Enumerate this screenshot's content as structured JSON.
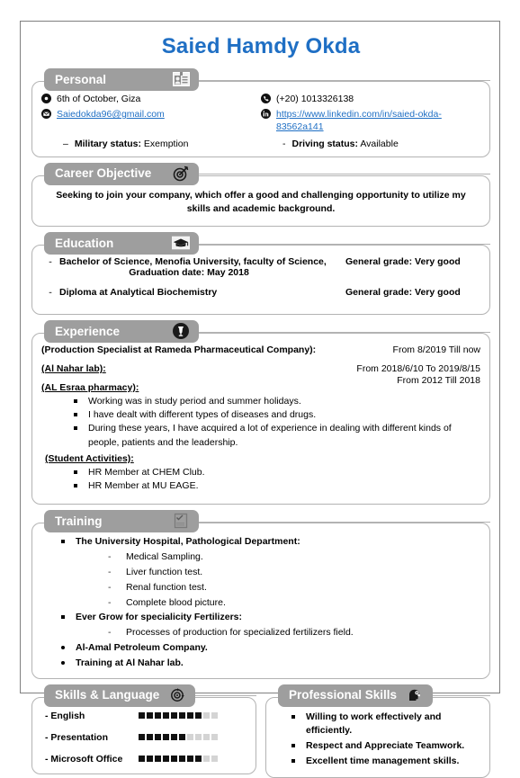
{
  "name": "Saied Hamdy Okda",
  "accent_color": "#1F6FC4",
  "header_color": "#9e9e9e",
  "sections": {
    "personal": {
      "title": "Personal",
      "icon": "id-card-icon",
      "location": "6th of October, Giza",
      "email": "Saiedokda96@gmail.com",
      "phone": "(+20) 1013326138",
      "linkedin": "https://www.linkedin.com/in/saied-okda-83562a141",
      "military_label": "Military status:",
      "military_value": "Exemption",
      "driving_label": "Driving status:",
      "driving_value": "Available"
    },
    "objective": {
      "title": "Career Objective",
      "icon": "target-icon",
      "text": "Seeking to join your company, which offer a good and challenging opportunity to utilize my skills and academic background."
    },
    "education": {
      "title": "Education",
      "icon": "graduation-cap-icon",
      "items": [
        {
          "line1": "Bachelor of Science, Menofia University, faculty of Science,",
          "line2": "Graduation date: May 2018",
          "grade": "General grade: Very good"
        },
        {
          "line1": "Diploma at Analytical Biochemistry",
          "line2": "",
          "grade": "General grade: Very good"
        }
      ]
    },
    "experience": {
      "title": "Experience",
      "icon": "briefcase-badge-icon",
      "roles": [
        {
          "title": "(Production Specialist at Rameda Pharmaceutical Company):",
          "date": "From 8/2019 Till now"
        },
        {
          "title": "(Al Nahar lab):",
          "date": "From 2018/6/10 To 2019/8/15"
        },
        {
          "title": " (AL Esraa pharmacy):",
          "date": "From 2012 Till 2018"
        }
      ],
      "esraa_points": [
        "Working was in study period and summer holidays.",
        "I have dealt with different types of diseases and drugs.",
        "During these years, I have acquired a lot of experience in dealing with different kinds of people, patients and the leadership."
      ],
      "activities_title": "(Student Activities):",
      "activities": [
        "HR Member at CHEM Club.",
        "HR Member at MU EAGE."
      ]
    },
    "training": {
      "title": "Training",
      "icon": "clipboard-check-icon",
      "items": [
        {
          "label": "The University Hospital, Pathological Department:",
          "marker": "square",
          "sub": [
            "Medical Sampling.",
            "Liver function test.",
            "Renal function test.",
            "Complete blood picture."
          ]
        },
        {
          "label": "Ever Grow for specialicity Fertilizers:",
          "marker": "square",
          "sub": [
            "Processes of production for specialized fertilizers field."
          ]
        },
        {
          "label": "Al-Amal Petroleum Company.",
          "marker": "round",
          "sub": []
        },
        {
          "label": "Training at Al Nahar lab.",
          "marker": "round",
          "sub": []
        }
      ]
    },
    "skills": {
      "title": "Skills & Language",
      "icon": "gear-target-icon",
      "max": 10,
      "items": [
        {
          "label": "- English",
          "value": 8
        },
        {
          "label": "- Presentation",
          "value": 6
        },
        {
          "label": "- Microsoft Office",
          "value": 8
        }
      ]
    },
    "professional": {
      "title": "Professional Skills",
      "icon": "head-gears-icon",
      "items": [
        "Willing to work effectively and efficiently.",
        "Respect and Appreciate Teamwork.",
        "Excellent time management skills."
      ]
    }
  }
}
